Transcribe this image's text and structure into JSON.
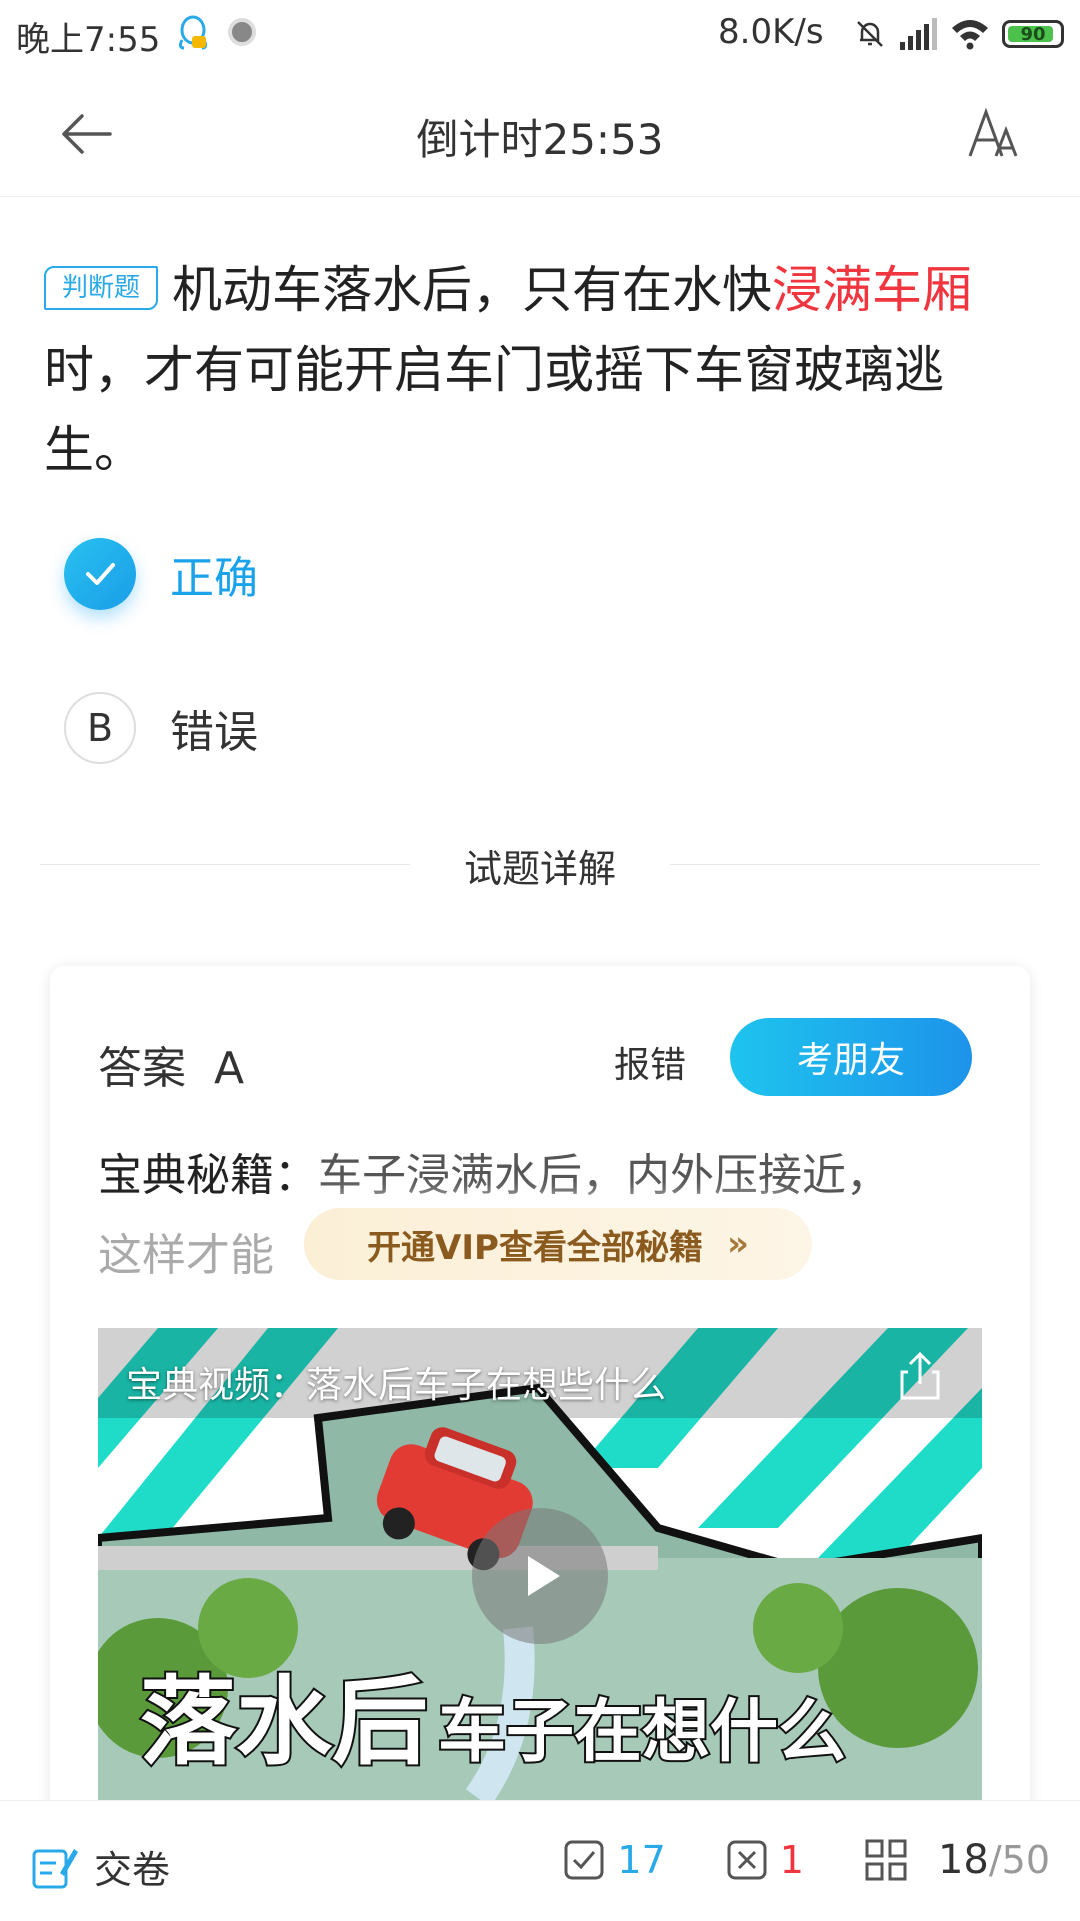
{
  "status_bar": {
    "time": "晚上7:55",
    "net_speed": "8.0K/s",
    "battery": "90"
  },
  "header": {
    "title": "倒计时25:53"
  },
  "question": {
    "type_tag": "判断题",
    "text_before": "机动车落水后，只有在水快",
    "text_highlight": "浸满车厢",
    "text_after": "时，才有可能开启车门或摇下车窗玻璃逃生。"
  },
  "options": [
    {
      "letter": "A",
      "label": "正确",
      "selected": true
    },
    {
      "letter": "B",
      "label": "错误",
      "selected": false
    }
  ],
  "section": {
    "title": "试题详解"
  },
  "explanation": {
    "answer_label": "答案",
    "answer_value": "A",
    "report_label": "报错",
    "friend_button": "考朋友",
    "tips_label": "宝典秘籍：",
    "tips_text": "车子浸满水后，内外压接近，",
    "tips_fade": "这样才能",
    "vip_button": "开通VIP查看全部秘籍"
  },
  "video": {
    "title": "宝典视频：落水后车子在想些什么",
    "caption_big": "落水后",
    "caption_small": "车子在想什么"
  },
  "bottom_bar": {
    "submit_label": "交卷",
    "correct_count": "17",
    "wrong_count": "1",
    "current": "18",
    "total": "/50"
  },
  "colors": {
    "accent": "#29a9e8",
    "highlight": "#f0353e"
  }
}
